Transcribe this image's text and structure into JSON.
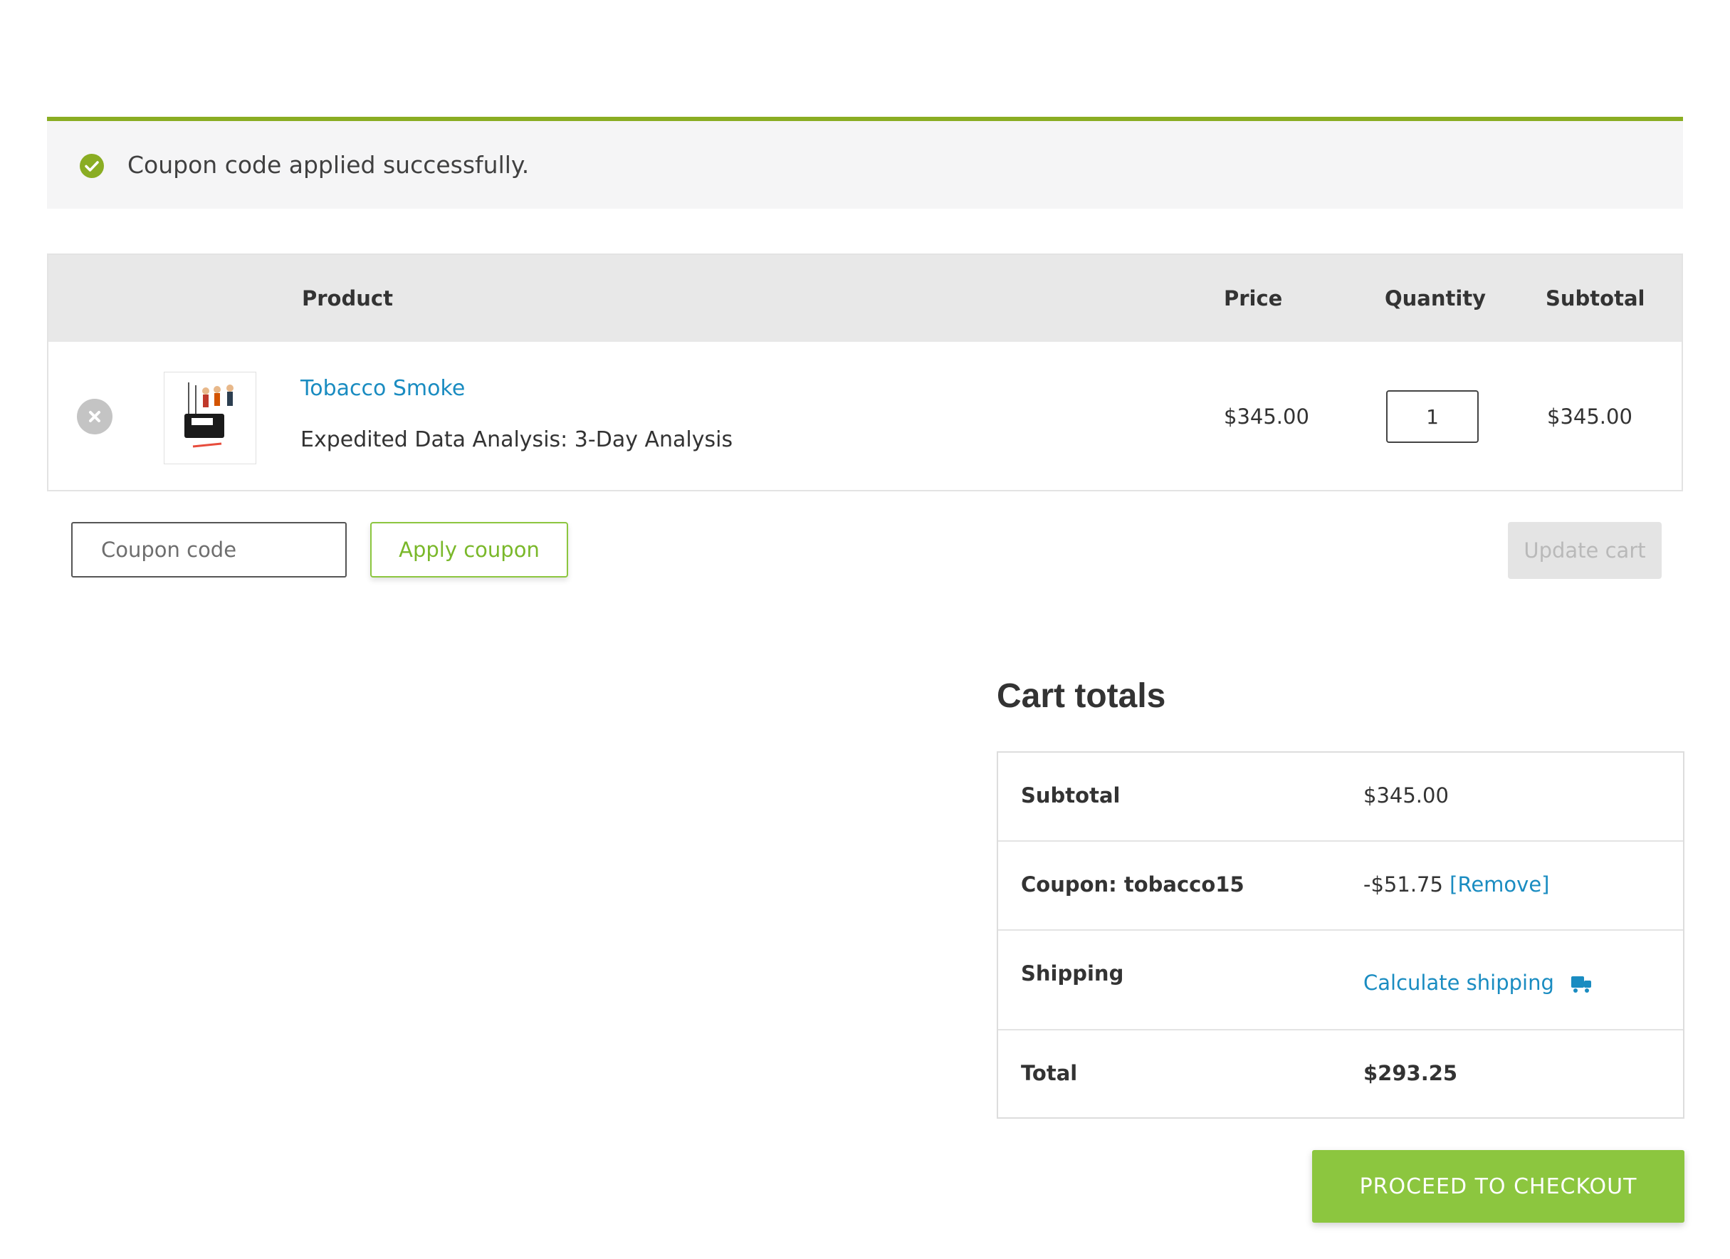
{
  "notice": {
    "message": "Coupon code applied successfully.",
    "icon": "check-circle-icon",
    "accent_color": "#8aad23"
  },
  "cart": {
    "headers": {
      "product": "Product",
      "price": "Price",
      "quantity": "Quantity",
      "subtotal": "Subtotal"
    },
    "item": {
      "name": "Tobacco Smoke",
      "meta": "Expedited Data Analysis: 3-Day Analysis",
      "price": "$345.00",
      "quantity": "1",
      "subtotal": "$345.00"
    },
    "coupon_placeholder": "Coupon code",
    "apply_label": "Apply coupon",
    "update_label": "Update cart"
  },
  "totals": {
    "title": "Cart totals",
    "subtotal_label": "Subtotal",
    "subtotal_value": "$345.00",
    "coupon_label": "Coupon: tobacco15",
    "coupon_value": "-$51.75",
    "coupon_remove": "[Remove]",
    "shipping_label": "Shipping",
    "shipping_value": "Calculate shipping",
    "total_label": "Total",
    "total_value": "$293.25"
  },
  "checkout_label": "PROCEED TO CHECKOUT",
  "colors": {
    "link": "#1a8cc1",
    "brand_green": "#8cc63f"
  }
}
